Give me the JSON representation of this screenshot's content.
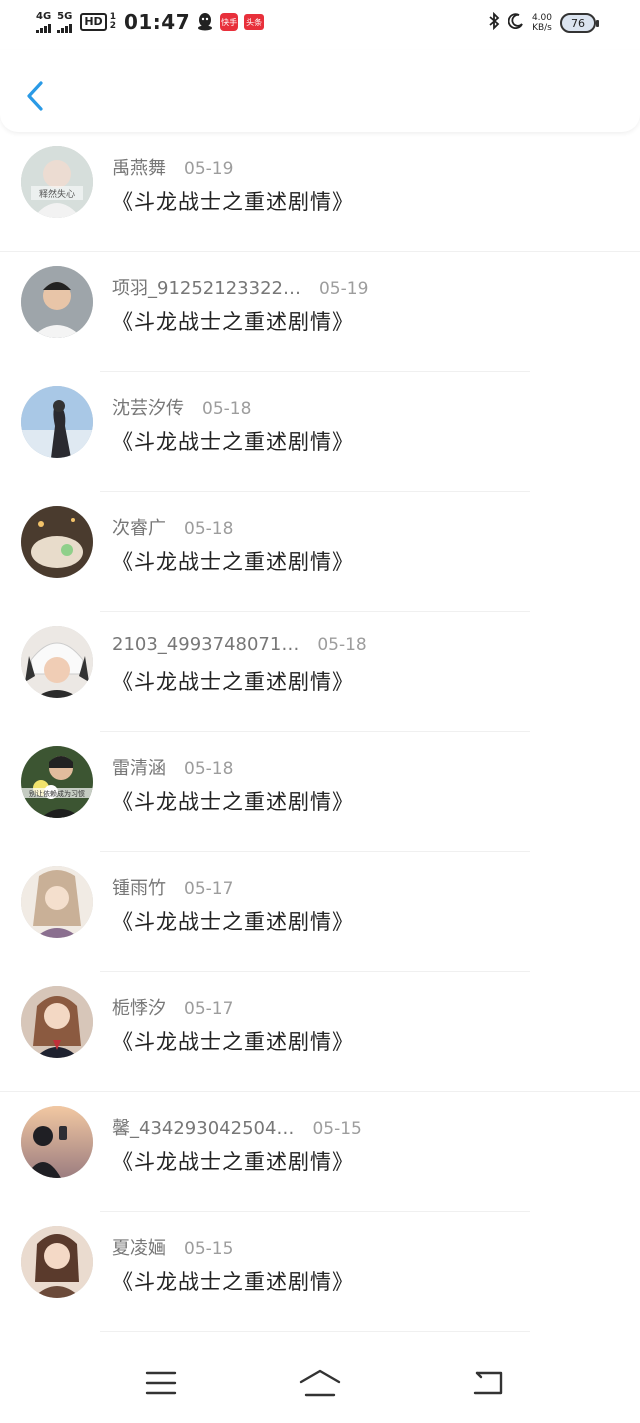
{
  "status_bar": {
    "network1": "4G",
    "network2": "5G",
    "hd": "HD",
    "hd_sub1": "1",
    "hd_sub2": "2",
    "time": "01:47",
    "app_badge1": "快手",
    "app_badge2": "头条",
    "speed_value": "4.00",
    "speed_unit": "KB/s",
    "battery": "76"
  },
  "comments": [
    {
      "name": "禹燕舞",
      "date": "05-19",
      "text": "《斗龙战士之重述剧情》",
      "avatar_color": "#c9d3cf"
    },
    {
      "name": "项羽_91252123322…",
      "date": "05-19",
      "text": "《斗龙战士之重述剧情》",
      "avatar_color": "#9aa2a8"
    },
    {
      "name": "沈芸汐传",
      "date": "05-18",
      "text": "《斗龙战士之重述剧情》",
      "avatar_color": "#8fb5d8"
    },
    {
      "name": "次睿广",
      "date": "05-18",
      "text": "《斗龙战士之重述剧情》",
      "avatar_color": "#6b5a4a"
    },
    {
      "name": "2103_4993748071…",
      "date": "05-18",
      "text": "《斗龙战士之重述剧情》",
      "avatar_color": "#e7e2de"
    },
    {
      "name": "雷清涵",
      "date": "05-18",
      "text": "《斗龙战士之重述剧情》",
      "avatar_color": "#3f5a33"
    },
    {
      "name": "锺雨竹",
      "date": "05-17",
      "text": "《斗龙战士之重述剧情》",
      "avatar_color": "#d9c7b2"
    },
    {
      "name": "栀悸汐",
      "date": "05-17",
      "text": "《斗龙战士之重述剧情》",
      "avatar_color": "#c98f7b"
    },
    {
      "name": "馨_434293042504…",
      "date": "05-15",
      "text": "《斗龙战士之重述剧情》",
      "avatar_color": "#5a4f57"
    },
    {
      "name": "夏凌婳",
      "date": "05-15",
      "text": "《斗龙战士之重述剧情》",
      "avatar_color": "#b67b5f"
    }
  ],
  "avatar_captions": {
    "first": "释然失心",
    "sixth": "别让依赖成为习惯"
  },
  "colors": {
    "accent": "#2a9ae6",
    "text": "#222222",
    "meta": "#777777",
    "date": "#9d9d9d"
  }
}
